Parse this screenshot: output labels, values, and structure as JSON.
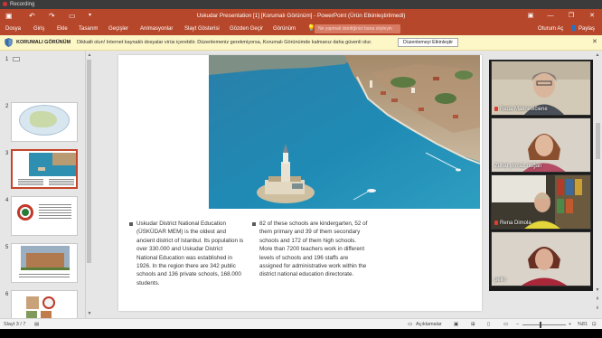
{
  "recording": {
    "label": "Recording"
  },
  "titlebar": {
    "title": "Uskudar Presentation [1] [Korumalı Görünüm] - PowerPoint (Ürün Etkinleştirilmedi)",
    "save_icon": "▣",
    "undo_icon": "↶",
    "redo_icon": "↷",
    "present_icon": "▭",
    "customize_icon": "▾",
    "ribbon_display_icon": "▣",
    "minimize_icon": "—",
    "restore_icon": "❐",
    "close_icon": "✕"
  },
  "menu": {
    "tabs": [
      "Dosya",
      "Giriş",
      "Ekle",
      "Tasarım",
      "Geçişler",
      "Animasyonlar",
      "Slayt Gösterisi",
      "Gözden Geçir",
      "Görünüm"
    ],
    "tellme_placeholder": "Ne yapmak istediğinizi bana söyleyin",
    "signin": "Oturum Aç",
    "share": "Paylaş"
  },
  "protected_view": {
    "label": "KORUMALI GÖRÜNÜM",
    "message": "Dikkatli olun! Internet kaynaklı dosyalar virüs içerebilir. Düzenlemeniz gerekmiyorsa, Korumalı Görünümde kalmanız daha güvenli olur.",
    "enable_button": "Düzenlemeyi Etkinleştir",
    "close_icon": "✕"
  },
  "thumbnails": [
    {
      "num": "1",
      "selected": false
    },
    {
      "num": "2",
      "selected": false
    },
    {
      "num": "3",
      "selected": true
    },
    {
      "num": "4",
      "selected": false
    },
    {
      "num": "5",
      "selected": false
    },
    {
      "num": "6",
      "selected": false
    }
  ],
  "slide": {
    "col1": "Uskudar District National Education (ÜSKÜDAR MEM) is the oldest and ancient district of Istanbul. Its population is over 330.000 and Uskudar District National Education was established in 1926. In the region there are 342 public schools and 136 private schools, 168.000 students.",
    "col2": "82 of these schools are kindergarten, 52 of them primary and 39 of them secondary schools and 172 of them high schools. More than 7200 teachers work in different levels of schools and 196 staffs are assigned for administrative work within the district national education directorate."
  },
  "participants": [
    {
      "name": "Reda Maknevičiene",
      "muted": true
    },
    {
      "name": "Zuhal yılmaz doğan",
      "muted": false
    },
    {
      "name": "Rena Dimola",
      "muted": true
    },
    {
      "name": "pelin",
      "muted": false
    }
  ],
  "status": {
    "slide_info": "Slayt 3 / 7",
    "notes": "Açıklamalar",
    "zoom": "%81",
    "minus": "−",
    "plus": "+"
  },
  "colors": {
    "accent": "#b7472a",
    "selected_thumb": "#c4462a",
    "protected_bar": "#fdf6c7"
  }
}
